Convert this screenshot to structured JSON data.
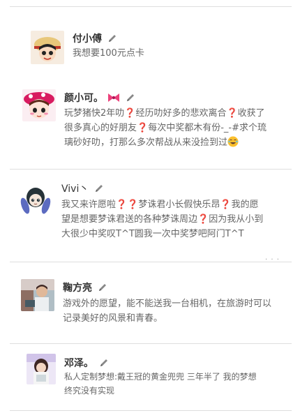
{
  "posts": [
    {
      "name": "付小傅",
      "lines": [
        [
          "我想要100元点卡"
        ]
      ]
    },
    {
      "name": "颜小可。",
      "lines": [
        [
          "玩梦猪快2年叻",
          "❓",
          "经历叻好多的悲欢离合",
          "❓",
          "收获了"
        ],
        [
          "很多真心的好朋友",
          "❓",
          "每次中奖都木有份-_-#求个琉"
        ],
        [
          "璃砂好叻，打那么多次帮战从来没捡到过"
        ]
      ]
    },
    {
      "name": "Vivi丶",
      "lines": [
        [
          "我又来许愿啦",
          "❓",
          "❓",
          "梦诛君小长假快乐昂",
          "❓",
          "我的愿"
        ],
        [
          "望是想要梦诛君送的各种梦诛周边",
          "❓",
          "因为我从小到"
        ],
        [
          "大很少中奖叹T^T圆我一次中奖梦吧阿门T^T"
        ]
      ],
      "more": "· · ·"
    },
    {
      "name": "鞠方亮",
      "lines": [
        [
          "游戏外的愿望，能不能送我一台相机，在旅游时可以"
        ],
        [
          "记录美好的风景和青春。"
        ]
      ]
    },
    {
      "name": "邓泽。",
      "lines": [
        [
          "私人定制梦想:戴王冠的黄金兜兜 三年半了 我的梦想"
        ],
        [
          "终究没有实现"
        ]
      ]
    }
  ],
  "icons": {
    "edit": "pencil-icon",
    "bow": "bow-icon",
    "emoji": "laugh-emoji",
    "question": "question-mark"
  },
  "colors": {
    "name": "#333333",
    "body_text": "#666666",
    "question_mark": "#d32f2f",
    "divider": "#dedede"
  }
}
